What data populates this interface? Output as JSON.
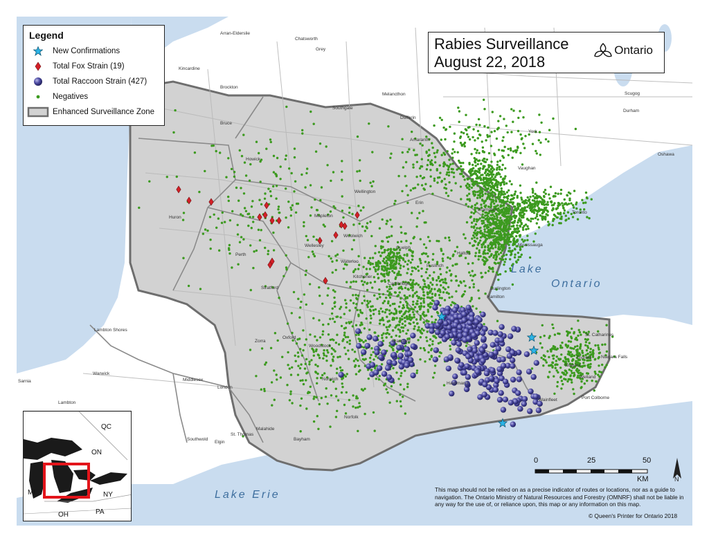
{
  "title": {
    "line1": "Rabies Surveillance",
    "line2": "August 22, 2018",
    "brand": "Ontario"
  },
  "legend": {
    "heading": "Legend",
    "items": [
      {
        "symbol": "star-icon",
        "label": "New Confirmations",
        "color": "#2bb5e8"
      },
      {
        "symbol": "diamond-icon",
        "label": "Total Fox Strain (19)",
        "color": "#d42027"
      },
      {
        "symbol": "sphere-icon",
        "label": "Total Raccoon Strain (427)",
        "color": "#3b3a8f"
      },
      {
        "symbol": "dot-icon",
        "label": "Negatives",
        "color": "#3c9a1f"
      },
      {
        "symbol": "zone-swatch",
        "label": "Enhanced Surveillance Zone",
        "color": "#cccccc"
      }
    ]
  },
  "water_labels": {
    "lake_ontario_1": "Lake",
    "lake_ontario_2": "Ontario",
    "lake_erie": "Lake Erie"
  },
  "places": [
    {
      "name": "Toronto",
      "size": "s"
    },
    {
      "name": "Mississauga",
      "size": "s"
    },
    {
      "name": "Brampton",
      "size": "s"
    },
    {
      "name": "Vaughan",
      "size": "s"
    },
    {
      "name": "Oshawa",
      "size": "s"
    },
    {
      "name": "Durham",
      "size": "s"
    },
    {
      "name": "York",
      "size": "s"
    },
    {
      "name": "Hamilton",
      "size": "s"
    },
    {
      "name": "Burlington",
      "size": "s"
    },
    {
      "name": "Halton",
      "size": "s"
    },
    {
      "name": "Guelph",
      "size": "s"
    },
    {
      "name": "Kitchener",
      "size": "s"
    },
    {
      "name": "Waterloo",
      "size": "s"
    },
    {
      "name": "Cambridge",
      "size": "s"
    },
    {
      "name": "Brantford",
      "size": "s"
    },
    {
      "name": "Woodstock",
      "size": "s"
    },
    {
      "name": "Oxford",
      "size": "s"
    },
    {
      "name": "Stratford",
      "size": "s"
    },
    {
      "name": "Perth",
      "size": "s"
    },
    {
      "name": "Huron",
      "size": "s"
    },
    {
      "name": "London",
      "size": "s"
    },
    {
      "name": "Middlesex",
      "size": "s"
    },
    {
      "name": "Sarnia",
      "size": "s"
    },
    {
      "name": "Lambton",
      "size": "s"
    },
    {
      "name": "Elgin",
      "size": "s"
    },
    {
      "name": "St. Thomas",
      "size": "s"
    },
    {
      "name": "Norfolk",
      "size": "s"
    },
    {
      "name": "Haldimand",
      "size": "s"
    },
    {
      "name": "Niagara",
      "size": "s"
    },
    {
      "name": "Welland",
      "size": "s"
    },
    {
      "name": "St. Catharines",
      "size": "s"
    },
    {
      "name": "Niagara Falls",
      "size": "s"
    },
    {
      "name": "Port Colborne",
      "size": "s"
    },
    {
      "name": "Thorold",
      "size": "s"
    },
    {
      "name": "Wellington",
      "size": "s"
    },
    {
      "name": "Dufferin",
      "size": "s"
    },
    {
      "name": "Grey",
      "size": "s"
    },
    {
      "name": "Bruce",
      "size": "s"
    },
    {
      "name": "Brockton",
      "size": "s"
    },
    {
      "name": "Kincardine",
      "size": "s"
    },
    {
      "name": "Mapleton",
      "size": "s"
    },
    {
      "name": "Wellesley",
      "size": "s"
    },
    {
      "name": "Woolwich",
      "size": "s"
    },
    {
      "name": "Zorra",
      "size": "s"
    },
    {
      "name": "Norwich",
      "size": "s"
    },
    {
      "name": "Bayham",
      "size": "s"
    },
    {
      "name": "Malahide",
      "size": "s"
    },
    {
      "name": "Southwold",
      "size": "s"
    },
    {
      "name": "Warwick",
      "size": "s"
    },
    {
      "name": "Lambton Shores",
      "size": "s"
    },
    {
      "name": "Scugog",
      "size": "s"
    },
    {
      "name": "Melancthon",
      "size": "s"
    },
    {
      "name": "Southgate",
      "size": "s"
    },
    {
      "name": "Chatsworth",
      "size": "s"
    },
    {
      "name": "Arran-Elderslie",
      "size": "s"
    },
    {
      "name": "Howick",
      "size": "s"
    },
    {
      "name": "Amaranth",
      "size": "s"
    },
    {
      "name": "Erin",
      "size": "s"
    },
    {
      "name": "Puslinch",
      "size": "s"
    },
    {
      "name": "Wainfleet",
      "size": "s"
    }
  ],
  "inset": {
    "labels": [
      "QC",
      "ON",
      "MI",
      "NY",
      "OH",
      "PA"
    ]
  },
  "scale": {
    "ticks": [
      "0",
      "25",
      "50"
    ],
    "unit": "KM"
  },
  "disclaimer": "This map should not be relied on as a precise indicator of routes or locations, nor as a guide to navigation. The Ontario Ministry of Natural Resources and Forestry (OMNRF) shall not be liable in any way for the use of, or reliance upon, this map or any information on this map.",
  "copyright": "© Queen's Printer for Ontario 2018",
  "colors": {
    "water": "#c9dcef",
    "land": "#ffffff",
    "zone": "#d2d2d2",
    "zone_border": "#6e6e6e",
    "negative": "#3c9a1f",
    "raccoon": "#3b3a8f",
    "fox": "#d42027",
    "star": "#2bb5e8"
  }
}
